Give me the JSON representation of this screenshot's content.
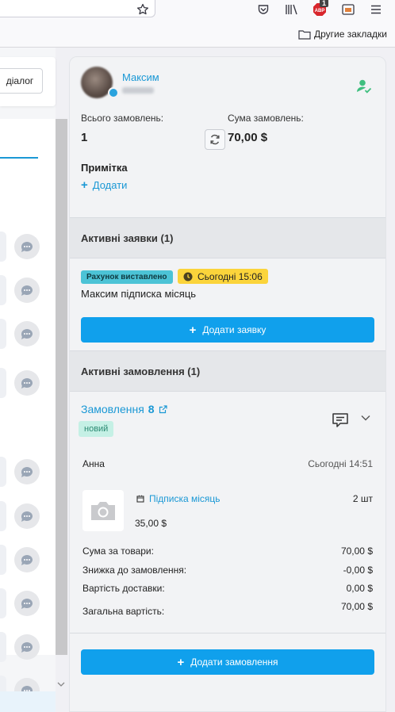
{
  "browser": {
    "bookmarks_folder": "Другие закладки",
    "abp_badge": "1",
    "abp_label": "ABP"
  },
  "left_panel": {
    "dialog_button": "діалог"
  },
  "customer": {
    "name": "Максим",
    "total_orders_label": "Всього замовлень:",
    "total_orders_value": "1",
    "orders_sum_label": "Сума замовлень:",
    "orders_sum_value": "70,00 $",
    "note_title": "Примітка",
    "add_note_label": "Додати"
  },
  "active_requests": {
    "title": "Активні заявки (1)",
    "status_badge": "Рахунок виставлено",
    "time_badge": "Сьогодні 15:06",
    "request_title": "Максим підписка місяць",
    "add_request_button": "Додати заявку"
  },
  "active_orders": {
    "title": "Активні замовлення (1)",
    "order_label": "Замовлення",
    "order_number": "8",
    "status": "новий",
    "manager": "Анна",
    "time": "Сьогодні 14:51",
    "product": {
      "name": "Підписка місяць",
      "qty": "2 шт",
      "price": "35,00 $"
    },
    "summary": [
      {
        "label": "Сума за товари:",
        "value": "70,00 $"
      },
      {
        "label": "Знижка до замовлення:",
        "value": "-0,00 $"
      },
      {
        "label": "Вартість доставки:",
        "value": "0,00 $"
      },
      {
        "label": "Загальна вартість:",
        "value": "70,00 $"
      }
    ],
    "add_order_button": "Додати замовлення"
  },
  "colors": {
    "accent": "#1a98d5",
    "button": "#10a0ec",
    "status_teal": "#4cc3d6",
    "time_yellow": "#fbd43b",
    "new_badge_bg": "#c5f0e5",
    "verified_green": "#3fbf7f"
  },
  "icons": [
    "star-icon",
    "pocket-icon",
    "library-icon",
    "abp-icon",
    "screenshot-icon",
    "menu-icon",
    "folder-icon",
    "chat-bubble-icon",
    "refresh-icon",
    "user-verified-icon",
    "clock-icon",
    "plus-icon",
    "external-link-icon",
    "comment-icon",
    "chevron-down-icon",
    "camera-icon",
    "product-icon"
  ]
}
